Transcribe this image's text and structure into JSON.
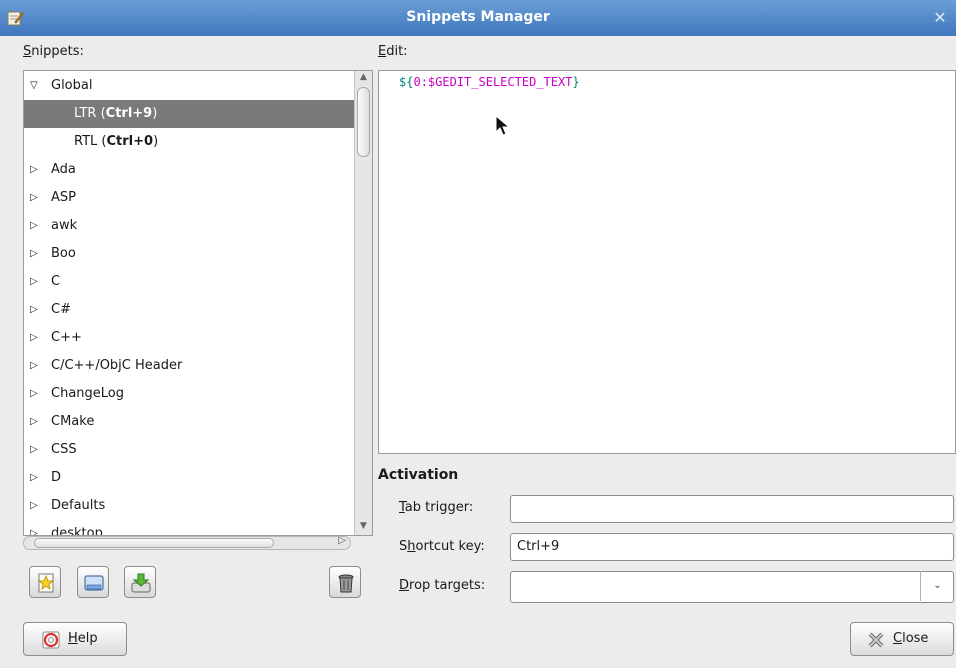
{
  "window": {
    "title": "Snippets Manager"
  },
  "labels": {
    "snippets": "Snippets:",
    "edit": "Edit:",
    "activation": "Activation",
    "tab_trigger": "Tab trigger:",
    "shortcut_key": "Shortcut key:",
    "drop_targets": "Drop targets:"
  },
  "tree": {
    "global": "Global",
    "children": [
      {
        "name": "LTR",
        "shortcut": "Ctrl+9",
        "selected": true
      },
      {
        "name": "RTL",
        "shortcut": "Ctrl+0",
        "selected": false
      }
    ],
    "languages": [
      "Ada",
      "ASP",
      "awk",
      "Boo",
      "C",
      "C#",
      "C++",
      "C/C++/ObjC Header",
      "ChangeLog",
      "CMake",
      "CSS",
      "D",
      "Defaults",
      "desktop"
    ]
  },
  "editor": {
    "code_dollar": "$",
    "code_open": "{",
    "code_var": "0:$GEDIT_SELECTED_TEXT",
    "code_close": "}"
  },
  "fields": {
    "tab_trigger": "",
    "shortcut_key": "Ctrl+9",
    "drop_targets": ""
  },
  "buttons": {
    "help": "Help",
    "close": "Close"
  },
  "icons": {
    "new": "new-snippet-icon",
    "import": "import-icon",
    "export": "export-icon",
    "delete": "trash-icon",
    "help": "help-icon",
    "close": "close-icon"
  }
}
